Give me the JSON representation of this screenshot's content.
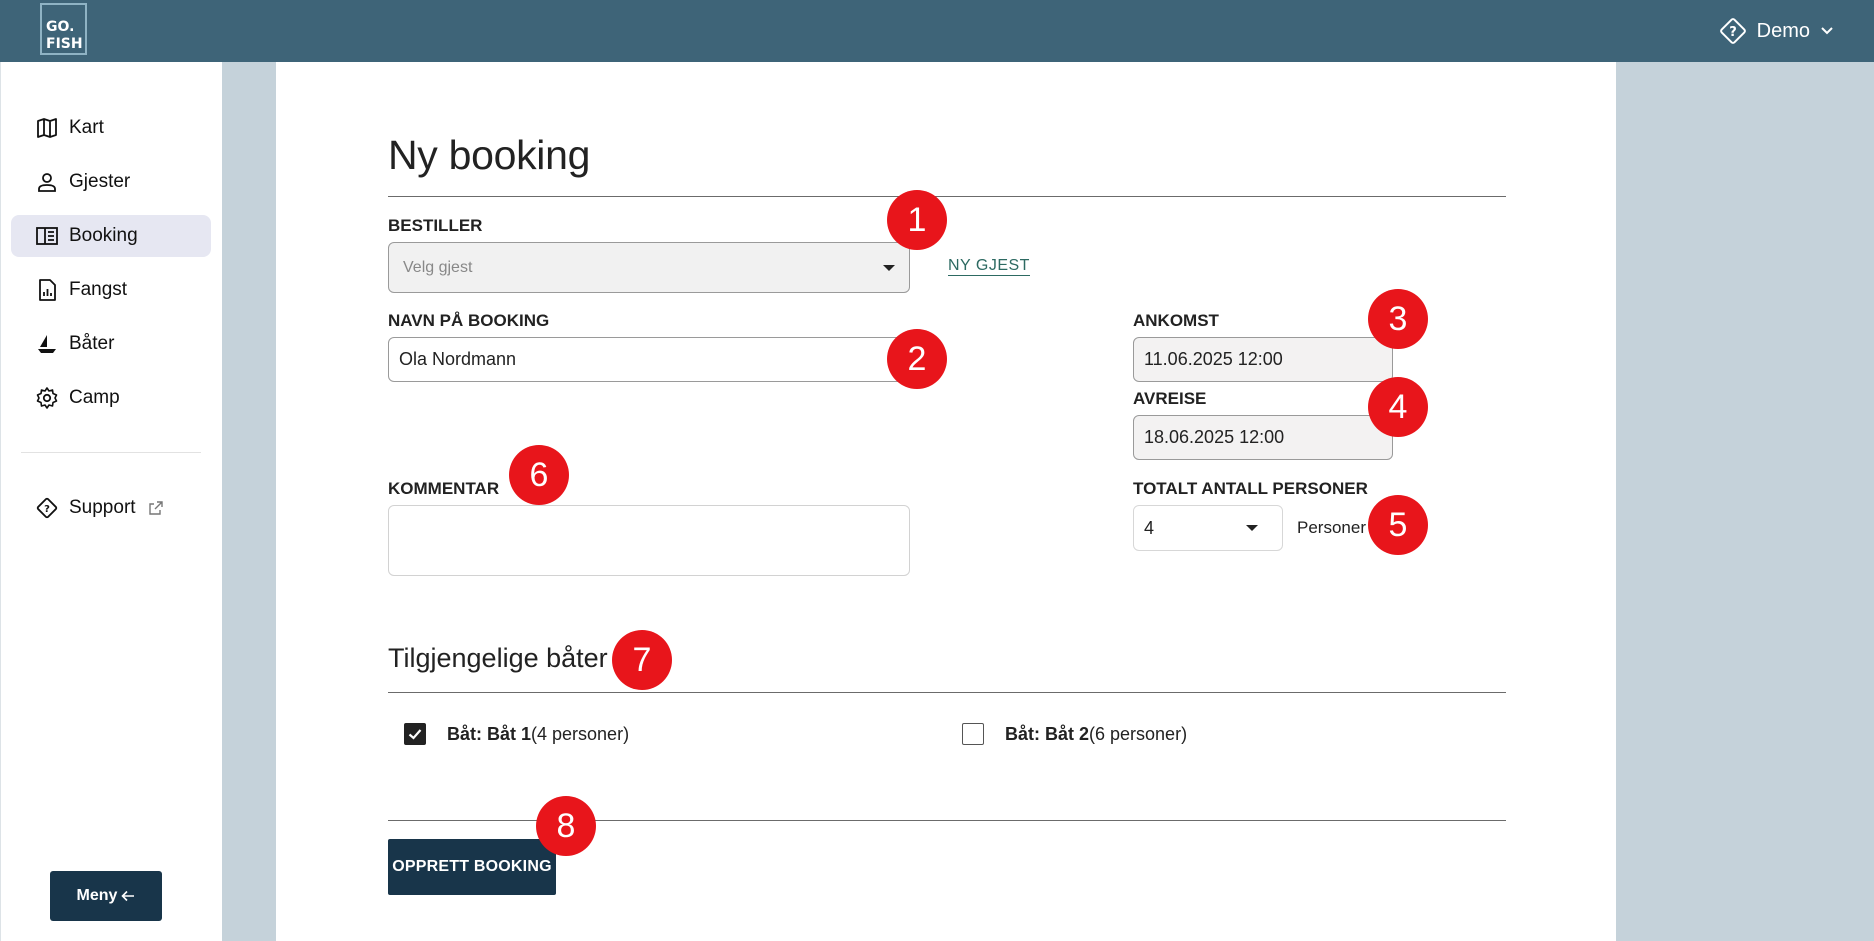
{
  "header": {
    "logo_line1": "GO.",
    "logo_line2": "FISH",
    "user_name": "Demo"
  },
  "sidebar": {
    "items": [
      {
        "label": "Kart",
        "icon": "map-icon"
      },
      {
        "label": "Gjester",
        "icon": "person-icon"
      },
      {
        "label": "Booking",
        "icon": "book-icon",
        "active": true
      },
      {
        "label": "Fangst",
        "icon": "report-icon"
      },
      {
        "label": "Båter",
        "icon": "sailboat-icon"
      },
      {
        "label": "Camp",
        "icon": "gear-icon"
      }
    ],
    "support_label": "Support",
    "menu_button": "Meny"
  },
  "form": {
    "title": "Ny booking",
    "bestiller_label": "BESTILLER",
    "bestiller_placeholder": "Velg gjest",
    "new_guest_link": "NY GJEST",
    "name_label": "NAVN PÅ BOOKING",
    "name_value": "Ola Nordmann",
    "arrival_label": "ANKOMST",
    "arrival_value": "11.06.2025 12:00",
    "departure_label": "AVREISE",
    "departure_value": "18.06.2025 12:00",
    "comment_label": "KOMMENTAR",
    "comment_value": "",
    "persons_label": "TOTALT ANTALL PERSONER",
    "persons_value": "4",
    "persons_unit": "Personer"
  },
  "boats": {
    "title": "Tilgjengelige båter",
    "items": [
      {
        "name": "Båt: Båt 1",
        "capacity": "(4 personer)",
        "checked": true
      },
      {
        "name": "Båt: Båt 2",
        "capacity": "(6 personer)",
        "checked": false
      }
    ]
  },
  "submit_label": "OPPRETT BOOKING",
  "markers": [
    "1",
    "2",
    "3",
    "4",
    "5",
    "6",
    "7",
    "8"
  ],
  "colors": {
    "topbar": "#3e6478",
    "primary": "#18354a",
    "marker": "#e8151b",
    "link": "#2d6a62",
    "active_nav": "#e6e7f2"
  }
}
